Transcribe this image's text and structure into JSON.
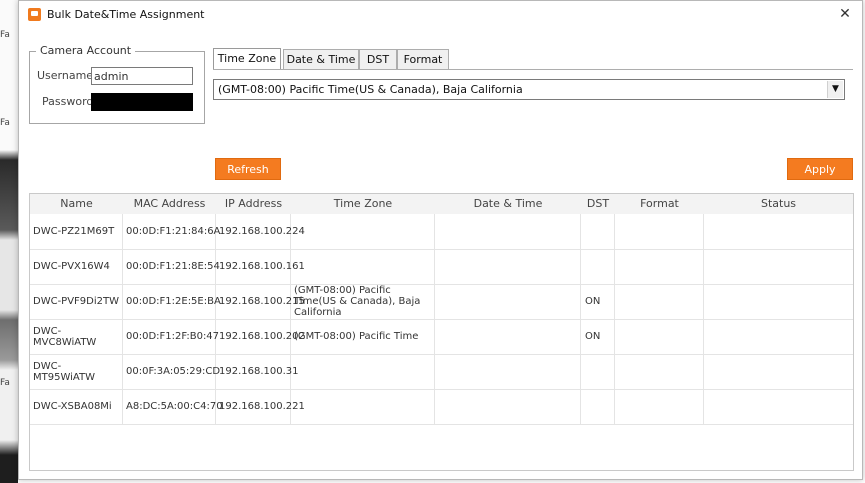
{
  "background_app": {
    "side_labels": [
      "Fa",
      "Fa",
      "Fa"
    ]
  },
  "dialog": {
    "title": "Bulk Date&Time Assignment",
    "close_glyph": "✕"
  },
  "account": {
    "legend": "Camera Account",
    "username_label": "Username",
    "username_value": "admin",
    "password_label": "Password"
  },
  "tabs": [
    {
      "label": "Time Zone",
      "active": true
    },
    {
      "label": "Date & Time",
      "active": false
    },
    {
      "label": "DST",
      "active": false
    },
    {
      "label": "Format",
      "active": false
    }
  ],
  "timezone": {
    "selected": "(GMT-08:00) Pacific Time(US & Canada), Baja California",
    "arrow_glyph": "▼"
  },
  "buttons": {
    "refresh": "Refresh",
    "apply": "Apply"
  },
  "accent_color": "#f47b20",
  "table": {
    "columns": [
      "Name",
      "MAC Address",
      "IP Address",
      "Time Zone",
      "Date & Time",
      "DST",
      "Format",
      "Status"
    ],
    "rows": [
      [
        "DWC-PZ21M69T",
        "00:0D:F1:21:84:6A",
        "192.168.100.224",
        "",
        "",
        "",
        "",
        ""
      ],
      [
        "DWC-PVX16W4",
        "00:0D:F1:21:8E:54",
        "192.168.100.161",
        "",
        "",
        "",
        "",
        ""
      ],
      [
        "DWC-PVF9Di2TW",
        "00:0D:F1:2E:5E:BA",
        "192.168.100.215",
        "(GMT-08:00) Pacific Time(US & Canada), Baja California",
        "",
        "ON",
        "",
        ""
      ],
      [
        "DWC-MVC8WiATW",
        "00:0D:F1:2F:B0:47",
        "192.168.100.202",
        "(GMT-08:00) Pacific Time",
        "",
        "ON",
        "",
        ""
      ],
      [
        "DWC-MT95WiATW",
        "00:0F:3A:05:29:CD",
        "192.168.100.31",
        "",
        "",
        "",
        "",
        ""
      ],
      [
        "DWC-XSBA08Mi",
        "A8:DC:5A:00:C4:70",
        "192.168.100.221",
        "",
        "",
        "",
        "",
        ""
      ]
    ]
  }
}
